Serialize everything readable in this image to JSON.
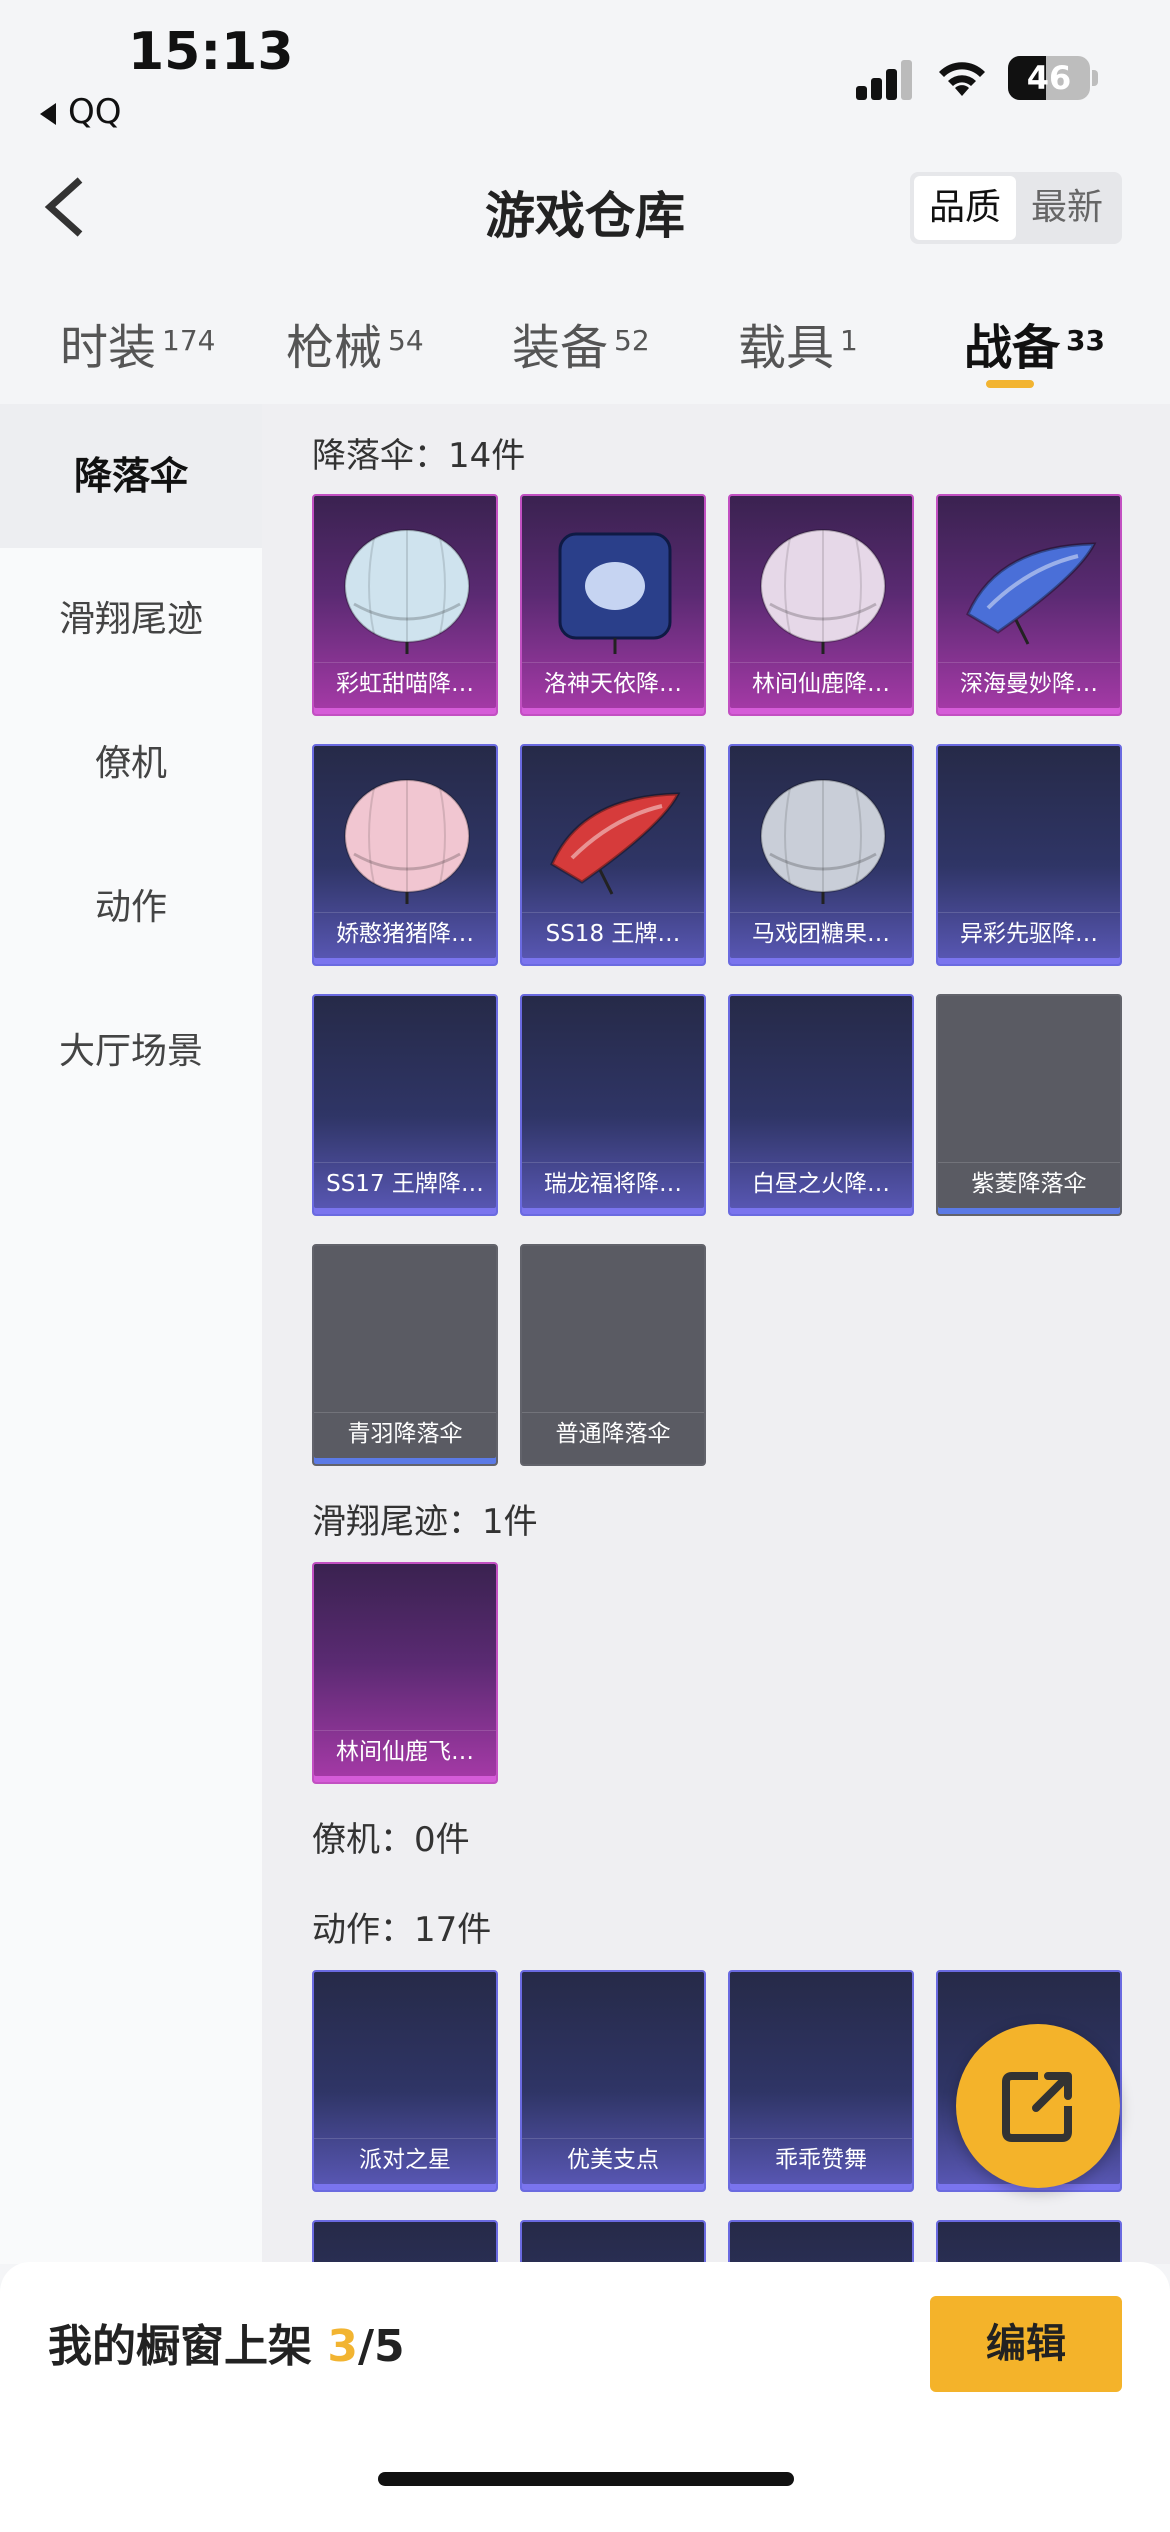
{
  "status_bar": {
    "time": "15:13",
    "back_app": "QQ",
    "battery": "46",
    "battery_level": 0.46
  },
  "header": {
    "title": "游戏仓库",
    "sort_options": [
      "品质",
      "最新"
    ],
    "sort_selected": "品质"
  },
  "categories": [
    {
      "label": "时装",
      "count": "174"
    },
    {
      "label": "枪械",
      "count": "54"
    },
    {
      "label": "装备",
      "count": "52"
    },
    {
      "label": "载具",
      "count": "1"
    },
    {
      "label": "战备",
      "count": "33"
    }
  ],
  "active_category": "战备",
  "sidebar": {
    "items": [
      "降落伞",
      "滑翔尾迹",
      "僚机",
      "动作",
      "大厅场景"
    ],
    "active": "降落伞"
  },
  "sections": {
    "parachute": {
      "title": "降落伞：14件",
      "items": [
        {
          "name": "彩虹甜喵降…",
          "rarity": "legendary",
          "art": "parachute-dome-icon",
          "tint": "#cfe3ee"
        },
        {
          "name": "洛神天依降…",
          "rarity": "legendary",
          "art": "parachute-square-icon",
          "tint": "#2a3f8a"
        },
        {
          "name": "林间仙鹿降…",
          "rarity": "legendary",
          "art": "parachute-dome-icon",
          "tint": "#e6d8e8"
        },
        {
          "name": "深海曼妙降…",
          "rarity": "legendary",
          "art": "parachute-wing-icon",
          "tint": "#4a6fd8"
        },
        {
          "name": "娇憨猪猪降…",
          "rarity": "epic",
          "art": "parachute-dome-icon",
          "tint": "#f1c6d1"
        },
        {
          "name": "SS18 王牌…",
          "rarity": "epic",
          "art": "parachute-wing-icon",
          "tint": "#d63b3b"
        },
        {
          "name": "马戏团糖果…",
          "rarity": "epic",
          "art": "parachute-dome-icon",
          "tint": "#c9ced8"
        },
        {
          "name": "异彩先驱降…",
          "rarity": "epic",
          "art": "",
          "tint": ""
        },
        {
          "name": "SS17 王牌降…",
          "rarity": "epic",
          "art": "",
          "tint": ""
        },
        {
          "name": "瑞龙福将降…",
          "rarity": "epic",
          "art": "",
          "tint": ""
        },
        {
          "name": "白昼之火降…",
          "rarity": "epic",
          "art": "",
          "tint": ""
        },
        {
          "name": "紫菱降落伞",
          "rarity": "rare",
          "art": "",
          "tint": ""
        },
        {
          "name": "青羽降落伞",
          "rarity": "rare",
          "art": "",
          "tint": ""
        },
        {
          "name": "普通降落伞",
          "rarity": "common",
          "art": "",
          "tint": ""
        }
      ]
    },
    "trail": {
      "title": "滑翔尾迹：1件",
      "items": [
        {
          "name": "林间仙鹿飞…",
          "rarity": "legendary"
        }
      ]
    },
    "wingman": {
      "title": "僚机：0件"
    },
    "emote": {
      "title": "动作：17件",
      "items": [
        {
          "name": "派对之星",
          "rarity": "epic"
        },
        {
          "name": "优美支点",
          "rarity": "epic"
        },
        {
          "name": "乖乖赞舞",
          "rarity": "epic"
        },
        {
          "name": "",
          "rarity": "epic"
        }
      ]
    }
  },
  "fab": {
    "icon": "share-external-icon"
  },
  "bottom_bar": {
    "prefix": "我的橱窗上架",
    "used": "3",
    "total": "/5",
    "edit_label": "编辑"
  },
  "colors": {
    "accent": "#f2b431",
    "legendary": "#c250c2",
    "epic": "#6a6ae0",
    "rare": "#5b7ae6"
  }
}
